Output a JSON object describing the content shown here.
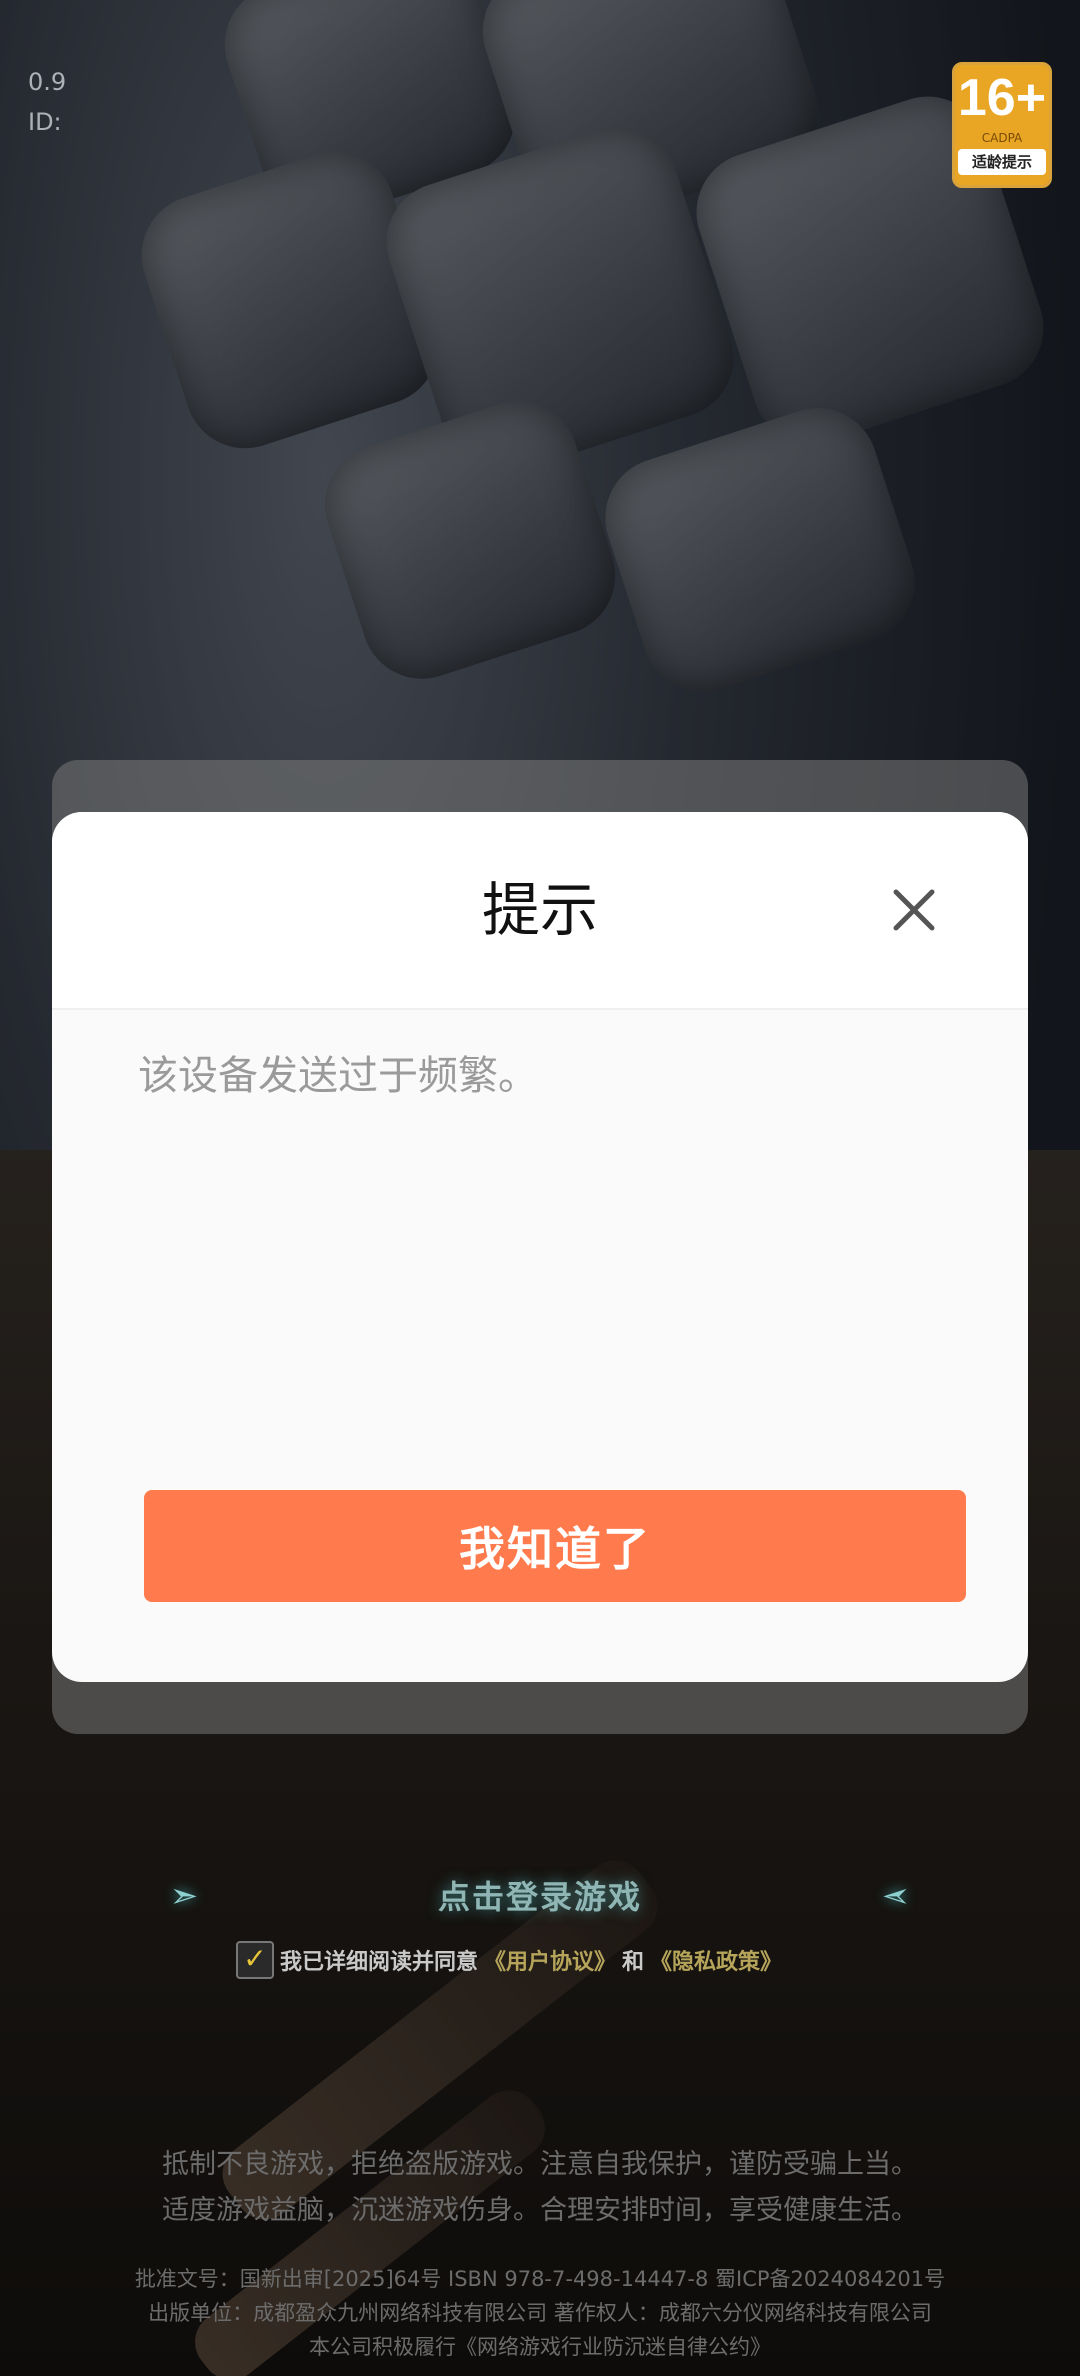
{
  "status": {
    "version_text": "0.9",
    "id_text": "ID:"
  },
  "age_badge": {
    "rating": "16+",
    "org": "CADPA",
    "tip": "适龄提示"
  },
  "dialog": {
    "title": "提示",
    "message": "该设备发送过于频繁。",
    "confirm_label": "我知道了",
    "close_icon": "close-icon"
  },
  "login": {
    "button_label": "点击登录游戏",
    "agree_prefix": "我已详细阅读并同意",
    "user_agreement": "《用户协议》",
    "and": "和",
    "privacy_policy": "《隐私政策》"
  },
  "notice": {
    "line1": "抵制不良游戏，拒绝盗版游戏。注意自我保护，谨防受骗上当。",
    "line2": "适度游戏益脑，沉迷游戏伤身。合理安排时间，享受健康生活。",
    "line3": "批准文号：国新出审[2025]64号 ISBN 978-7-498-14447-8 蜀ICP备2024084201号",
    "line4": "出版单位：成都盈众九州网络科技有限公司 著作权人：成都六分仪网络科技有限公司",
    "line5": "本公司积极履行《网络游戏行业防沉迷自律公约》"
  },
  "colors": {
    "confirm_bg": "#ff7a4c",
    "modal_bg": "#fafafa",
    "link_gold": "#b5a45a"
  }
}
